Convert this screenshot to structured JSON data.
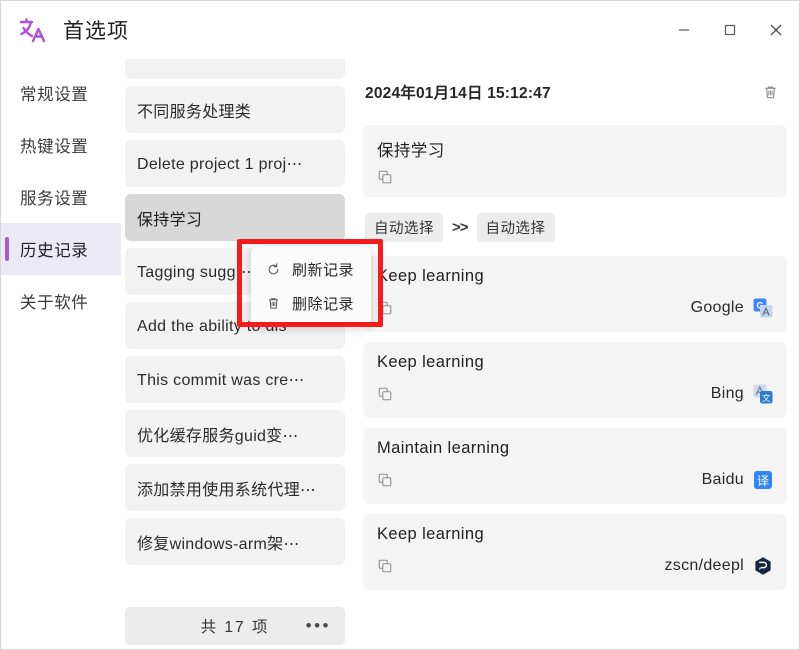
{
  "window": {
    "title": "首选项",
    "logo_icon": "translate-icon",
    "controls": [
      {
        "name": "minimize",
        "icon": "minimize-icon"
      },
      {
        "name": "maximize",
        "icon": "maximize-icon"
      },
      {
        "name": "close",
        "icon": "close-icon"
      }
    ]
  },
  "sidebar": {
    "items": [
      {
        "label": "常规设置",
        "active": false
      },
      {
        "label": "热键设置",
        "active": false
      },
      {
        "label": "服务设置",
        "active": false
      },
      {
        "label": "历史记录",
        "active": true
      },
      {
        "label": "关于软件",
        "active": false
      }
    ],
    "active_indicator_color": "#a25fd0",
    "active_background": "#eceaf5"
  },
  "history_list": {
    "items": [
      {
        "label": "",
        "clipped": true,
        "selected": false
      },
      {
        "label": "不同服务处理类",
        "clipped": false,
        "selected": false
      },
      {
        "label": "Delete project 1 proj⋯",
        "clipped": false,
        "selected": false
      },
      {
        "label": "保持学习",
        "clipped": false,
        "selected": true
      },
      {
        "label": "Tagging sugg⋯",
        "clipped": false,
        "selected": false
      },
      {
        "label": "Add the ability to dis⋯",
        "clipped": false,
        "selected": false
      },
      {
        "label": "This commit was cre⋯",
        "clipped": false,
        "selected": false
      },
      {
        "label": "优化缓存服务guid变⋯",
        "clipped": false,
        "selected": false
      },
      {
        "label": "添加禁用使用系统代理⋯",
        "clipped": false,
        "selected": false
      },
      {
        "label": "修复windows-arm架⋯",
        "clipped": false,
        "selected": false
      }
    ],
    "footer": {
      "count_text": "共 17 项",
      "more_label": "•••",
      "more_icon": "ellipsis-icon"
    }
  },
  "context_menu": {
    "items": [
      {
        "label": "刷新记录",
        "icon": "refresh-icon"
      },
      {
        "label": "删除记录",
        "icon": "trash-icon"
      }
    ]
  },
  "detail": {
    "timestamp": "2024年01月14日 15:12:47",
    "delete_icon": "trash-icon",
    "source": {
      "text": "保持学习",
      "copy_icon": "copy-icon"
    },
    "language": {
      "from": "自动选择",
      "arrow": ">>",
      "to": "自动选择"
    },
    "results": [
      {
        "text": "Keep learning",
        "service": "Google",
        "service_icon": "google-translate-icon",
        "copy_icon": "copy-icon"
      },
      {
        "text": "Keep learning",
        "service": "Bing",
        "service_icon": "bing-translate-icon",
        "copy_icon": "copy-icon"
      },
      {
        "text": "Maintain learning",
        "service": "Baidu",
        "service_icon": "baidu-translate-icon",
        "copy_icon": "copy-icon"
      },
      {
        "text": "Keep learning",
        "service": "zscn/deepl",
        "service_icon": "deepl-icon",
        "copy_icon": "copy-icon"
      }
    ]
  },
  "annotation": {
    "type": "red-highlight-box",
    "color": "#f71b1b"
  }
}
